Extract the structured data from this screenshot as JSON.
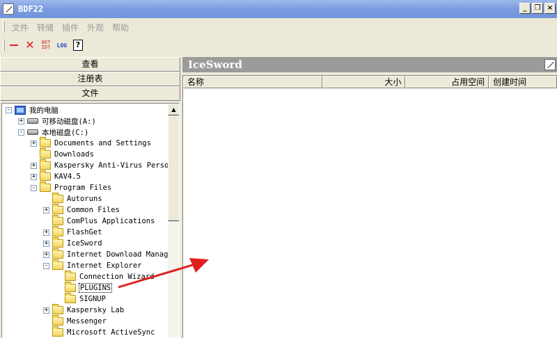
{
  "window": {
    "title": "BDF22",
    "btn_min": "_",
    "btn_restore": "❐",
    "btn_close": "×"
  },
  "menu": [
    "文件",
    "转储",
    "插件",
    "外观",
    "帮助"
  ],
  "toolbar": {
    "text_btn_line1": "8DT",
    "text_btn_line2": "IDT",
    "log": "LOG",
    "help": "?"
  },
  "left_tabs": [
    "查看",
    "注册表",
    "文件"
  ],
  "tree": [
    {
      "label": "我的电脑",
      "level": 0,
      "expander": "-",
      "icon": "computer-icon"
    },
    {
      "label": "可移动磁盘(A:)",
      "level": 1,
      "expander": "+",
      "icon": "drive-icon"
    },
    {
      "label": "本地磁盘(C:)",
      "level": 1,
      "expander": "-",
      "icon": "drive-icon"
    },
    {
      "label": "Documents and Settings",
      "level": 2,
      "expander": "+",
      "icon": "folder-icon"
    },
    {
      "label": "Downloads",
      "level": 2,
      "expander": "",
      "icon": "folder-icon"
    },
    {
      "label": "Kaspersky Anti-Virus Person",
      "level": 2,
      "expander": "+",
      "icon": "folder-icon"
    },
    {
      "label": "KAV4.5",
      "level": 2,
      "expander": "+",
      "icon": "folder-icon"
    },
    {
      "label": "Program Files",
      "level": 2,
      "expander": "-",
      "icon": "folder-icon"
    },
    {
      "label": "Autoruns",
      "level": 3,
      "expander": "",
      "icon": "folder-icon"
    },
    {
      "label": "Common Files",
      "level": 3,
      "expander": "+",
      "icon": "folder-icon"
    },
    {
      "label": "ComPlus Applications",
      "level": 3,
      "expander": "",
      "icon": "folder-icon"
    },
    {
      "label": "FlashGet",
      "level": 3,
      "expander": "+",
      "icon": "folder-icon"
    },
    {
      "label": "IceSword",
      "level": 3,
      "expander": "+",
      "icon": "folder-icon"
    },
    {
      "label": "Internet Download Manage",
      "level": 3,
      "expander": "+",
      "icon": "folder-icon"
    },
    {
      "label": "Internet Explorer",
      "level": 3,
      "expander": "-",
      "icon": "folder-icon"
    },
    {
      "label": "Connection Wizard",
      "level": 4,
      "expander": "",
      "icon": "folder-icon"
    },
    {
      "label": "PLUGINS",
      "level": 4,
      "expander": "",
      "icon": "folder-icon",
      "selected": true
    },
    {
      "label": "SIGNUP",
      "level": 4,
      "expander": "",
      "icon": "folder-icon"
    },
    {
      "label": "Kaspersky Lab",
      "level": 3,
      "expander": "+",
      "icon": "folder-icon"
    },
    {
      "label": "Messenger",
      "level": 3,
      "expander": "",
      "icon": "folder-icon"
    },
    {
      "label": "Microsoft ActiveSync",
      "level": 3,
      "expander": "",
      "icon": "folder-icon"
    }
  ],
  "right": {
    "title": "IceSword",
    "columns": [
      "名称",
      "大小",
      "占用空间",
      "创建时间"
    ]
  },
  "colors": {
    "titlebar": "#7e9ee0",
    "panel_header": "#9b9b9b",
    "arrow": "#e02020"
  }
}
